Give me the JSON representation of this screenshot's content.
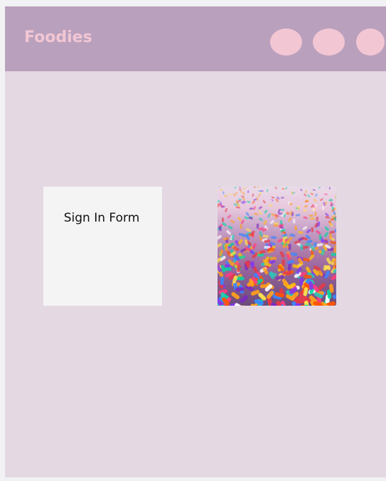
{
  "header": {
    "brand": "Foodies",
    "nav_items": [
      {
        "label": ""
      },
      {
        "label": ""
      },
      {
        "label": ""
      }
    ]
  },
  "main": {
    "form": {
      "title": "Sign In Form"
    },
    "image": {
      "subject": "sprinkles-photo"
    }
  },
  "colors": {
    "header_bg": "#b9a0bd",
    "page_bg": "#e4d9e3",
    "brand_text": "#f2c6d3",
    "nav_dot": "#f2c6d3",
    "form_bg": "#f4f4f4"
  }
}
